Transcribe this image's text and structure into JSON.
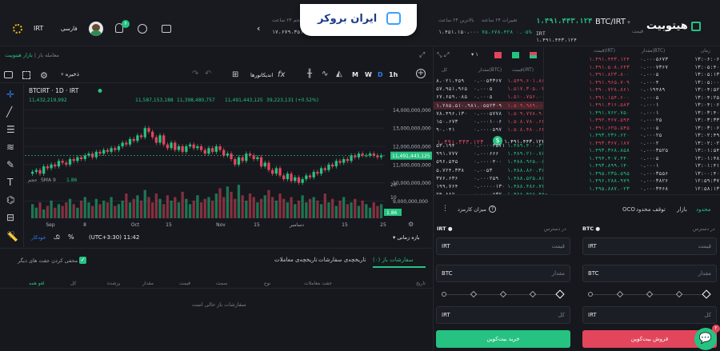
{
  "logo": {
    "brand": "هیتوبیت",
    "banner": "ایران بروکر"
  },
  "header": {
    "pair": "BTC/IRT",
    "pair_sub": "قیمت",
    "price_top": "۱،۴۹۱،۴۴۳،۱۲۴",
    "price_sub": "IRT ۱،۴۹۱،۴۴۳،۱۲۴",
    "stats": [
      {
        "label": "تغییرات ۲۴ ساعته",
        "value": "۷۵،۶۷۸،۴۲۸ ۰.۰۵%"
      },
      {
        "label": "بالاترین ۲۴ ساعت",
        "value": "۱،۵۲۷،۵۰۳،۷۹۴"
      },
      {
        "label": "پایین‌ترین ۲۴ ساعت",
        "value": "۱،۴۵۱،۱۵۰،۰۰۰"
      },
      {
        "label": "حجم ۲۴ ساعت (IRT)",
        "value": "۱۷،۶۷۹،۳۵۱،۰۸۶"
      }
    ],
    "currency": "IRT",
    "user": "فارسی",
    "notif_count": "۶"
  },
  "breadcrumb": {
    "a": "بازار هیتوبیت",
    "b": "معامله باز"
  },
  "chart_toolbar": {
    "indicators": "اندیکاتورها",
    "save": "ذخیره",
    "intervals": [
      "1h",
      "D",
      "W",
      "M"
    ],
    "timeframe": "بازه زمانی",
    "clock": "(UTC+3:30) 11:42",
    "log": "لگ",
    "pct": "%",
    "auto": "خودکار"
  },
  "chart_data": {
    "type": "candlestick",
    "symbol": "BTCIRT · 1D · IRT",
    "ohlc": {
      "o": "11,432,219,992",
      "h": "11,587,153,188",
      "l": "11,398,480,757",
      "c": "11,491,443,125",
      "chg": "39,223,131 (+0.52%)"
    },
    "y_ticks": [
      "14,000,000,000",
      "13,000,000,000",
      "12,000,000,000",
      "11,000,000,000",
      "10,000,000,000",
      "9,000,000,000"
    ],
    "ylim": [
      8800000000,
      14500000000
    ],
    "x_ticks": [
      "Sep",
      "8",
      "Oct",
      "15",
      "Nov",
      "15",
      "دسامبر",
      "15",
      "25"
    ],
    "last_price": "11,491,443,125",
    "vol_ticks": [
      "20",
      "10",
      "1.86"
    ],
    "sma_label": "SMA 9",
    "sma_value": "1.86",
    "vol_label": "حجم",
    "closes": [
      10.6,
      10.7,
      10.5,
      10.9,
      10.8,
      11.0,
      10.9,
      11.2,
      11.1,
      11.0,
      11.3,
      11.2,
      11.4,
      11.3,
      11.5,
      11.6,
      11.4,
      11.7,
      11.6,
      11.8,
      11.7,
      11.9,
      11.8,
      12.0,
      12.2,
      12.1,
      12.4,
      12.3,
      12.6,
      12.5,
      13.0,
      12.8,
      12.5,
      12.2,
      12.6,
      12.1,
      11.9,
      12.2,
      11.8,
      12.0,
      11.7,
      12.0,
      12.1,
      11.9,
      12.0,
      11.8,
      11.6,
      11.9,
      11.7,
      12.0,
      11.8,
      11.5,
      11.6,
      11.3,
      11.0,
      11.4,
      11.2,
      11.6,
      11.5,
      11.3,
      11.4,
      10.9,
      11.1,
      10.7,
      10.5,
      10.8,
      10.4,
      10.2,
      10.5,
      10.1,
      10.3,
      10.0,
      10.2,
      10.4,
      10.3,
      10.6,
      10.5,
      10.8,
      10.7,
      11.0,
      10.9,
      11.2,
      11.1,
      11.3,
      11.2,
      11.5,
      11.4,
      11.6,
      11.5,
      11.5,
      11.6,
      11.5,
      11.4,
      11.5
    ],
    "volumes": [
      8,
      6,
      9,
      5,
      7,
      10,
      6,
      8,
      7,
      9,
      11,
      8,
      6,
      10,
      12,
      9,
      7,
      11,
      8,
      10,
      9,
      12,
      7,
      8,
      10,
      14,
      9,
      11,
      13,
      10,
      16,
      12,
      9,
      14,
      11,
      8,
      13,
      10,
      12,
      9,
      15,
      11,
      8,
      10,
      13,
      9,
      11,
      12,
      10,
      14,
      17,
      12,
      18,
      15,
      11,
      19,
      13,
      10,
      14,
      12,
      9,
      11,
      13,
      16,
      12,
      10,
      14,
      11,
      9,
      12,
      8,
      10,
      13,
      9,
      11,
      12,
      10,
      8,
      14,
      9,
      11,
      7,
      10,
      12,
      8,
      9,
      11,
      7,
      10,
      8,
      6,
      9,
      7,
      8
    ]
  },
  "orders": {
    "tabs": [
      "سفارشات باز (۰)",
      "تاریخچه‌ی سفارشات",
      "تاریخچه‌ی معاملات"
    ],
    "hide_label": "مخفی کردن جفت های دیگر",
    "columns": [
      "تاریخ",
      "جفت معاملات",
      "نوع",
      "سمت",
      "قیمت",
      "مقدار",
      "پرشده",
      "کل",
      "لغو همه"
    ],
    "empty": "سفارشات باز خالی است"
  },
  "orderbook": {
    "headers": [
      "قیمت(IRT)",
      "مقدار(BTC)",
      "کل"
    ],
    "asks": [
      [
        "۱،۵۴۹،۶۰۱،۸۸۶",
        "۰.۰۰۵۳۳۶۷",
        "۸،۰۲۱،۴۵۹"
      ],
      [
        "۱،۵۱۷،۳۰۵،۰۳۳",
        "۰.۰۰۰۵",
        "۵۷،۹۵۱،۹۶۵"
      ],
      [
        "۱،۵۱۰،۷۵۶،۰۰۰",
        "۰.۰۰۰۵",
        "۶۷،۶۵۹،۰۸۵"
      ],
      [
        "۱،۵۰۹،۹۸۹،۰۰۰",
        "۰.۰۵۵۲۳۰۹",
        "۱،۲۸۵،۵۱۰،۹۸۱"
      ],
      [
        "۱،۵۰۹،۷۷۸،۹۰۰",
        "۰.۰۰۰۵۷۷۸",
        "۷۸،۴۹۶،۱۳۰"
      ],
      [
        "۱،۵۰۸،۷۸۰،۶۴۷",
        "۰.۰۰۰۱۰۰۶",
        "۱۵۰،۶۷۳"
      ],
      [
        "۱،۵۰۸،۴۸۰،۶۴۵",
        "۰.۰۰۰۰۵۹۷",
        "۹۰،۰۴۱"
      ]
    ],
    "mid_price": "۱،۴۹۱،۴۴۳،۱۲۴",
    "mid_irt": "۱،۴۹۱،۴۴۳،۱۲۴",
    "bids": [
      [
        "۱،۴۸۹،۴۰۰،۳۱۵",
        "۰.۰۰۰۰۳۵۷۱",
        "۵۳،۱۹۴"
      ],
      [
        "۱،۴۸۹،۲۱۰،۷۸۰",
        "۰.۰۰۰۶۶۶",
        "۹۹۱،۷۷۷"
      ],
      [
        "۱،۴۸۸،۹۶۵،۰۸۸",
        "۰.۰۰۰۰۴۰۰",
        "۵۹۶،۵۴۵"
      ],
      [
        "۱،۴۸۸،۸۶۰،۳۸۲",
        "۰.۰۰۵۳",
        "۵،۷۲۴،۳۳۸"
      ],
      [
        "۱،۴۸۸،۵۲۵،۸۶۰",
        "۰.۰۰۰۲۵۹",
        "۳۷۶،۶۳۶"
      ],
      [
        "۱،۴۸۸،۴۸۶،۷۴۸",
        "۰.۰۰۰۰۰۱۳۰",
        "۱۹۹،۷۶۴"
      ],
      [
        "۱،۴۸۸،۴۵۸،۹۴۸",
        "۰.۰۰۰۰۵۳۲",
        "۷۹،۸۸۷"
      ]
    ]
  },
  "trades": {
    "headers": [
      "قیمت(IRT)",
      "مقدار(BTC)",
      "زمان"
    ],
    "rows": [
      [
        "۱،۴۹۱،۴۴۳،۱۲۴",
        "۰.۰۰۰۵۶۷۳",
        "۱۳:۰۶:۰۶",
        "r"
      ],
      [
        "۱،۴۹۱،۵۰۸،۶۴۳",
        "۰.۰۰۰۷۳۶۷",
        "۱۳:۰۵:۴۰",
        "r"
      ],
      [
        "۱،۴۹۱،۸۲۳،۸۰۰",
        "۰.۰۰۰۵",
        "۱۳:۰۵:۱۳",
        "r"
      ],
      [
        "۱،۴۹۱،۹۶۵،۷۰۹",
        "۰.۰۰۰۴",
        "۱۳:۰۵:۰۰",
        "r"
      ],
      [
        "۱،۴۹۰،۷۲۸،۸۶۱",
        "۰.۰۱۹۴۸۹",
        "۱۳:۰۴:۵۲",
        "r"
      ],
      [
        "۱،۴۹۱،۱۵۴،۶۰۰",
        "۰.۰۰۰۵",
        "۱۳:۰۴:۲۵",
        "r"
      ],
      [
        "۱،۴۹۱،۳۱۶،۵۸۳",
        "۰.۰۰۰۱",
        "۱۳:۰۴:۰۶",
        "r"
      ],
      [
        "۱،۴۹۱،۷۶۲،۷۵۰",
        "۰.۰۰۰۱",
        "۱۳:۰۳:۴۰",
        "g"
      ],
      [
        "۱،۴۹۲،۴۶۷،۵۹۴",
        "۰.۰۰۰۲۵",
        "۱۳:۰۳:۳۳",
        "r"
      ],
      [
        "۱،۴۹۱،۶۲۵،۵۴۵",
        "۰.۰۰۰۵",
        "۱۳:۰۳:۰۶",
        "r"
      ],
      [
        "۱،۴۹۳،۲۳۶،۶۲۰",
        "۰.۰۰۰۲۵",
        "۱۳:۰۲:۴۹",
        "g"
      ],
      [
        "۱،۴۹۳،۳۶۷،۱۸۷",
        "۰.۰۰۰۲",
        "۱۳:۰۲:۰۲",
        "r"
      ],
      [
        "۱،۴۹۳،۳۶۸،۸۵۸",
        "۰.۰۰۰۳۵۲۵",
        "۱۳:۰۱:۵۴",
        "g"
      ],
      [
        "۱،۴۹۴،۴۰۷،۴۴۰",
        "۰.۰۰۰۵",
        "۱۳:۰۱:۴۸",
        "g"
      ],
      [
        "۱،۴۹۳،۸۹۹،۱۴۰",
        "۰.۰۰۰۱",
        "۱۳:۰۱:۴۱",
        "g"
      ],
      [
        "۱،۴۹۵،۲۳۵،۵۹۵",
        "۰.۰۰۰۳۵۵۶",
        "۱۳:۰۰:۴۰",
        "g"
      ],
      [
        "۱،۴۹۶،۲۸۸،۹۷۹",
        "۰.۰۰۰۳۸۲۶",
        "۱۲:۵۹:۳۷",
        "g"
      ],
      [
        "۱،۴۹۵،۸۸۷،۰۲۳",
        "۰.۰۰۰۳۴۶۸",
        "۱۲:۵۸:۱۳",
        "g"
      ]
    ]
  },
  "trade_form": {
    "tabs": [
      "محدود",
      "بازار",
      "توقف محدود",
      "OCO"
    ],
    "fee": "میزان کارمزد",
    "buy": {
      "asset": "IRT",
      "available": "در دسترس",
      "price_ph": "قیمت",
      "price_unit": "IRT",
      "amount_ph": "مقدار",
      "amount_unit": "BTC",
      "total_ph": "کل",
      "total_unit": "IRT",
      "button": "خرید بیت‌کوین"
    },
    "sell": {
      "asset": "BTC",
      "available": "در دسترس",
      "price_ph": "قیمت",
      "price_unit": "IRT",
      "amount_ph": "مقدار",
      "amount_unit": "BTC",
      "total_ph": "کل",
      "total_unit": "IRT",
      "button": "فروش بیت‌کوین"
    },
    "chat_badge": "۲"
  },
  "colors": {
    "green": "#26c281",
    "red": "#e2465c",
    "bg": "#16181d"
  }
}
